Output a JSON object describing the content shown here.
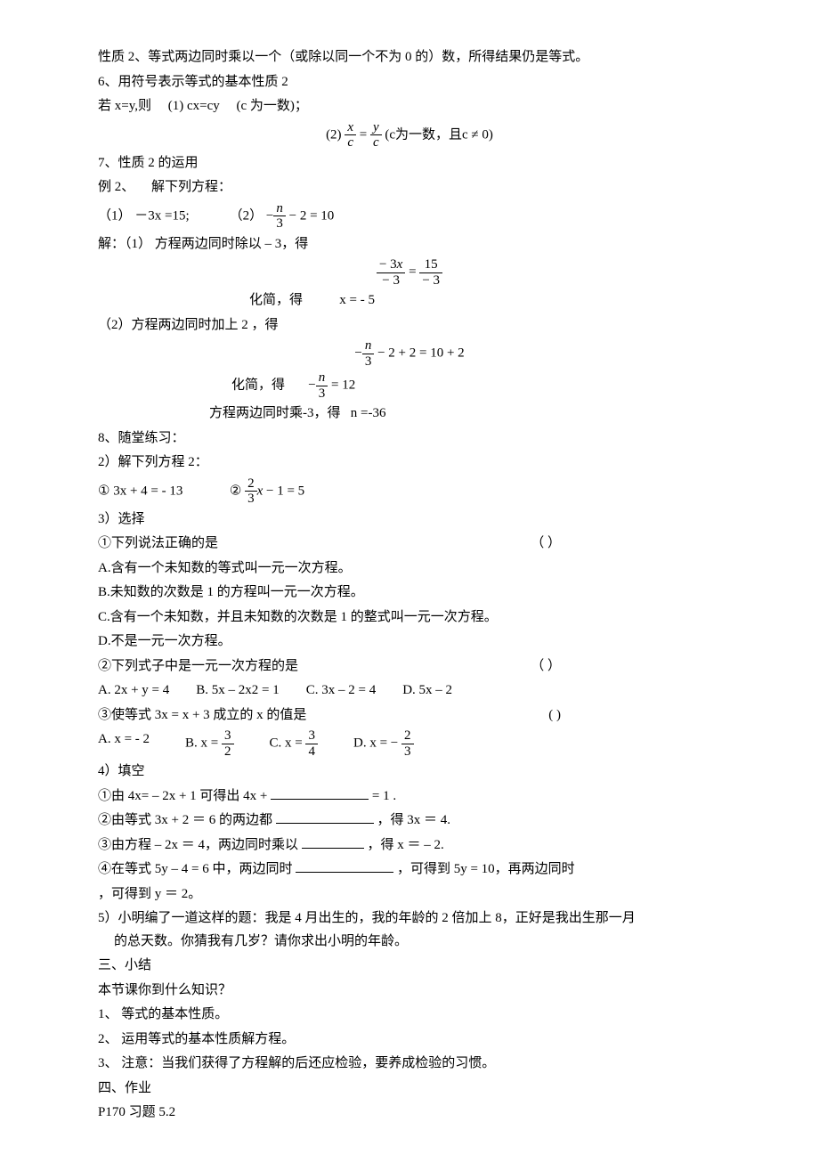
{
  "intro": {
    "prop2": "性质 2、等式两边同时乘以一个（或除以同一个不为 0 的）数，所得结果仍是等式。"
  },
  "s6": {
    "title": "6、用符号表示等式的基本性质 2",
    "line1_a": "若 x=y,则",
    "line1_b": "(1) cx=cy",
    "line1_c": "(c 为一数)；",
    "eq_prefix": "(2)",
    "eq_tail": "(c为一数，且c ≠ 0)"
  },
  "s7": {
    "title": "7、性质 2 的运用",
    "ex_label": "例 2、",
    "ex_text": "解下列方程：",
    "eq1_label": "（1）",
    "eq1": "－3x =15;",
    "eq2_label": "（2）",
    "sol_label": "解：（1）",
    "sol1_text": "方程两边同时除以 – 3，得",
    "simplify_label": "化简，得",
    "sol1_result": "x = - 5",
    "sol2_label": "（2）方程两边同时加上 2 ，得",
    "sol2_step2_pre": "方程两边同时乘-3，得",
    "sol2_result": "n =-36"
  },
  "s8": {
    "title": "8、随堂练习：",
    "p2_title": "2）解下列方程 2：",
    "p2_a_label": "①",
    "p2_a": "3x + 4 = - 13",
    "p2_b_label": "②",
    "p3_title": "3）选择",
    "q1": "①下列说法正确的是",
    "paren": "（           ）",
    "q1_A": "A.含有一个未知数的等式叫一元一次方程。",
    "q1_B": "B.未知数的次数是 1 的方程叫一元一次方程。",
    "q1_C": "C.含有一个未知数，并且未知数的次数是 1 的整式叫一元一次方程。",
    "q1_D": "D.不是一元一次方程。",
    "q2": "②下列式子中是一元一次方程的是",
    "q2_A": "A. 2x + y = 4",
    "q2_B": "B.    5x – 2x2 = 1",
    "q2_C": "C. 3x – 2 = 4",
    "q2_D": "D.    5x – 2",
    "q3": "③使等式 3x = x + 3 成立的 x 的值是",
    "paren2": "(               )",
    "q3_A": "A. x = - 2",
    "q3_B_pre": "B. x =",
    "q3_C_pre": "C. x =",
    "q3_D_pre": "D. x =",
    "p4_title": "4）填空",
    "f1_a": "①由 4x= – 2x + 1 可得出 4x +",
    "f1_b": "= 1 .",
    "f2_a": "②由等式 3x + 2 ＝ 6 的两边都",
    "f2_b": "，得 3x ＝ 4.",
    "f3_a": "③由方程  – 2x ＝ 4，两边同时乘以",
    "f3_b": "，得 x ＝ – 2.",
    "f4_a": "④在等式 5y – 4 = 6 中，两边同时",
    "f4_b": "，可得到 5y = 10，再两边同时",
    "f4_c": "，可得到 y ＝ 2。",
    "p5": "5）小明编了一道这样的题：我是 4 月出生的，我的年龄的 2 倍加上 8，正好是我出生那一月的总天数。你猜我有几岁？请你求出小明的年龄。"
  },
  "s_summary": {
    "title": "三、小结",
    "q": "本节课你到什么知识？",
    "i1": "1、  等式的基本性质。",
    "i2": "2、  运用等式的基本性质解方程。",
    "i3": "3、  注意：当我们获得了方程解的后还应检验，要养成检验的习惯。"
  },
  "s_hw": {
    "title": "四、作业",
    "content": "P170       习题 5.2"
  }
}
